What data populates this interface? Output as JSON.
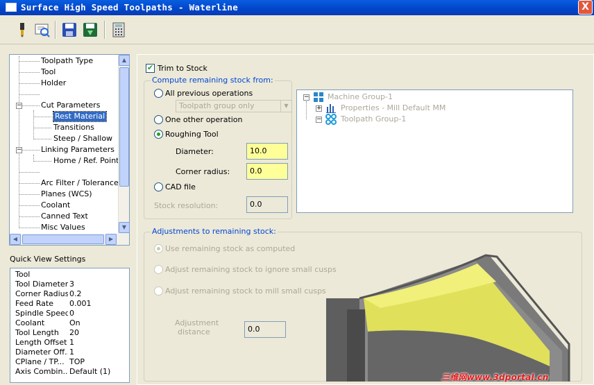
{
  "window": {
    "title": "Surface High Speed Toolpaths - Waterline",
    "close_glyph": "X"
  },
  "toolbar": {
    "icons": [
      "tool-icon",
      "view-icon",
      "save-icon",
      "load-icon",
      "calculator-icon"
    ]
  },
  "nav_tree": {
    "items": [
      {
        "label": "Toolpath Type",
        "level": 1
      },
      {
        "label": "Tool",
        "level": 1
      },
      {
        "label": "Holder",
        "level": 1
      },
      {
        "label": "",
        "level": 1
      },
      {
        "label": "Cut Parameters",
        "level": 1,
        "expander": "−"
      },
      {
        "label": "Rest Material",
        "level": 2,
        "selected": true
      },
      {
        "label": "Transitions",
        "level": 2
      },
      {
        "label": "Steep / Shallow",
        "level": 2
      },
      {
        "label": "Linking Parameters",
        "level": 1,
        "expander": "−"
      },
      {
        "label": "Home / Ref. Points",
        "level": 2
      },
      {
        "label": "",
        "level": 1
      },
      {
        "label": "Arc Filter / Tolerance",
        "level": 1
      },
      {
        "label": "Planes (WCS)",
        "level": 1
      },
      {
        "label": "Coolant",
        "level": 1
      },
      {
        "label": "Canned Text",
        "level": 1
      },
      {
        "label": "Misc Values",
        "level": 1
      }
    ]
  },
  "quick_view": {
    "label": "Quick View Settings",
    "rows": [
      {
        "key": "Tool",
        "value": ""
      },
      {
        "key": "Tool Diameter",
        "value": "3"
      },
      {
        "key": "Corner Radius",
        "value": "0.2"
      },
      {
        "key": "Feed Rate",
        "value": "0.001"
      },
      {
        "key": "Spindle Speed",
        "value": "0"
      },
      {
        "key": "Coolant",
        "value": "On"
      },
      {
        "key": "Tool Length",
        "value": "20"
      },
      {
        "key": "Length Offset",
        "value": "1"
      },
      {
        "key": "Diameter Off...",
        "value": "1"
      },
      {
        "key": "CPlane / TP...",
        "value": "TOP"
      },
      {
        "key": "Axis Combin...",
        "value": "Default (1)"
      }
    ]
  },
  "main": {
    "trim_to_stock": {
      "label": "Trim to Stock",
      "checked": true
    },
    "compute_group": {
      "title": "Compute remaining stock from:",
      "all_previous": "All previous operations",
      "combo_value": "Toolpath group only",
      "one_other": "One other operation",
      "roughing_tool": "Roughing Tool",
      "diameter_label": "Diameter:",
      "diameter_value": "10.0",
      "corner_radius_label": "Corner radius:",
      "corner_radius_value": "0.0",
      "cad_file": "CAD file",
      "stock_resolution_label": "Stock resolution:",
      "stock_resolution_value": "0.0",
      "selected": "roughing_tool"
    },
    "op_tree": {
      "items": [
        {
          "label": "Machine Group-1",
          "icon": "machine-group-icon"
        },
        {
          "label": "Properties - Mill Default MM",
          "icon": "properties-icon"
        },
        {
          "label": "Toolpath Group-1",
          "icon": "toolpath-group-icon"
        }
      ]
    },
    "adjust_group": {
      "title": "Adjustments to remaining stock:",
      "use_as_computed": "Use remaining stock as computed",
      "ignore_small_cusps": "Adjust remaining stock to ignore small cusps",
      "mill_small_cusps": "Adjust remaining stock to mill small cusps",
      "adjustment_distance_label_1": "Adjustment",
      "adjustment_distance_label_2": "distance",
      "adjustment_distance_value": "0.0",
      "selected": "use_as_computed"
    }
  },
  "watermark": "三维网www.3dportal.cn",
  "colors": {
    "title_bar": "#0a5ee0",
    "selection": "#316ac5",
    "highlight_field": "#ffff99",
    "accent_text": "#0046d5"
  }
}
